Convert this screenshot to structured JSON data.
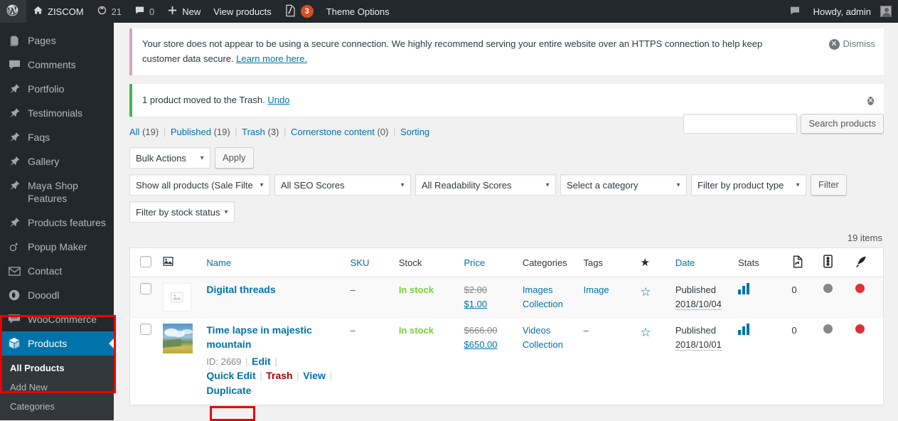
{
  "adminbar": {
    "logo_icon": "wordpress-logo-icon",
    "site_name": "ZISCOM",
    "site_icon": "home-icon",
    "updates_icon": "updates-icon",
    "updates_count": "21",
    "comments_icon": "comment-bubble-icon",
    "comments_count": "0",
    "new_icon": "plus-icon",
    "new_label": "New",
    "view_products_label": "View products",
    "yoast_icon": "yoast-seo-icon",
    "yoast_badge": "3",
    "theme_options_label": "Theme Options",
    "notifications_icon": "notification-bubble-icon",
    "howdy_label": "Howdy, admin",
    "avatar_icon": "user-avatar-icon"
  },
  "sidebar": {
    "items": [
      {
        "label": "Pages",
        "icon": "pages-icon"
      },
      {
        "label": "Comments",
        "icon": "comments-icon"
      },
      {
        "label": "Portfolio",
        "icon": "pin-icon"
      },
      {
        "label": "Testimonials",
        "icon": "pin-icon"
      },
      {
        "label": "Faqs",
        "icon": "pin-icon"
      },
      {
        "label": "Gallery",
        "icon": "pin-icon"
      },
      {
        "label": "Maya Shop Features",
        "icon": "pin-icon"
      },
      {
        "label": "Products features",
        "icon": "pin-icon"
      },
      {
        "label": "Popup Maker",
        "icon": "popup-maker-icon"
      },
      {
        "label": "Contact",
        "icon": "envelope-icon"
      },
      {
        "label": "Dooodl",
        "icon": "dooodl-icon"
      },
      {
        "label": "WooCommerce",
        "icon": "woocommerce-icon"
      }
    ],
    "active_item": {
      "label": "Products",
      "icon": "products-box-icon"
    },
    "submenu": [
      {
        "label": "All Products",
        "current": true
      },
      {
        "label": "Add New",
        "current": false
      },
      {
        "label": "Categories",
        "current": false
      }
    ]
  },
  "notices": {
    "https": {
      "text": "Your store does not appear to be using a secure connection. We highly recommend serving your entire website over an HTTPS connection to help keep customer data secure.",
      "link_text": "Learn more here.",
      "dismiss_label": "Dismiss",
      "dismiss_icon": "dismiss-circle-icon",
      "accent_color": "#d8a2c4"
    },
    "trash": {
      "text": "1 product moved to the Trash.",
      "link_text": "Undo",
      "dismiss_icon": "dismiss-circle-icon",
      "accent_color": "#46b450"
    }
  },
  "views": [
    {
      "label": "All",
      "count": "(19)"
    },
    {
      "label": "Published",
      "count": "(19)"
    },
    {
      "label": "Trash",
      "count": "(3)"
    },
    {
      "label": "Cornerstone content",
      "count": "(0)"
    },
    {
      "label": "Sorting",
      "count": ""
    }
  ],
  "search": {
    "value": "",
    "placeholder": "",
    "button_label": "Search products"
  },
  "toolbar": {
    "bulk_actions_label": "Bulk Actions",
    "apply_label": "Apply",
    "filters": [
      "Show all products (Sale Filte",
      "All SEO Scores",
      "All Readability Scores",
      "Select a category",
      "Filter by product type"
    ],
    "filter_button_label": "Filter",
    "stock_filter_label": "Filter by stock status"
  },
  "count": {
    "items_label": "19 items"
  },
  "table": {
    "headers": [
      {
        "label": "",
        "name": "select-all-checkbox",
        "kind": "checkbox"
      },
      {
        "label": "",
        "name": "thumbnail-icon",
        "kind": "icon-image"
      },
      {
        "label": "Name",
        "name": "col-name",
        "kind": "sortable"
      },
      {
        "label": "SKU",
        "name": "col-sku",
        "kind": "sortable"
      },
      {
        "label": "Stock",
        "name": "col-stock",
        "kind": "plain"
      },
      {
        "label": "Price",
        "name": "col-price",
        "kind": "sortable"
      },
      {
        "label": "Categories",
        "name": "col-categories",
        "kind": "plain"
      },
      {
        "label": "Tags",
        "name": "col-tags",
        "kind": "plain"
      },
      {
        "label": "",
        "name": "col-featured-star",
        "kind": "icon-star"
      },
      {
        "label": "Date",
        "name": "col-date",
        "kind": "sortable"
      },
      {
        "label": "Stats",
        "name": "col-stats",
        "kind": "plain"
      },
      {
        "label": "",
        "name": "col-duplicate-icon",
        "kind": "icon-duplicate"
      },
      {
        "label": "",
        "name": "col-linkcount-icon",
        "kind": "icon-links"
      },
      {
        "label": "",
        "name": "col-readability-icon",
        "kind": "icon-feather"
      }
    ],
    "rows": [
      {
        "name": "Digital threads",
        "thumb": "placeholder",
        "sku": "–",
        "stock": "In stock",
        "price_regular": "$2.00",
        "price_sale": "$1.00",
        "categories": "Images Collection",
        "tags": "Image",
        "featured": "star-empty-icon",
        "date_status": "Published",
        "date_value": "2018/10/04",
        "stats": "stats-bar-icon",
        "links": "0",
        "seo_dot": "#888888",
        "readability_dot": "#dc3232",
        "actions": []
      },
      {
        "name": "Time lapse in majestic mountain",
        "thumb": "mountain-photo",
        "sku": "–",
        "stock": "In stock",
        "price_regular": "$666.00",
        "price_sale": "$650.00",
        "categories": "Videos Collection",
        "tags": "–",
        "featured": "star-empty-icon",
        "date_status": "Published",
        "date_value": "2018/10/01",
        "stats": "stats-bar-icon",
        "links": "0",
        "seo_dot": "#888888",
        "readability_dot": "#dc3232",
        "actions": [
          {
            "label": "ID: 2669",
            "kind": "text"
          },
          {
            "label": "Edit",
            "kind": "link"
          },
          {
            "label": "Quick Edit",
            "kind": "link"
          },
          {
            "label": "Trash",
            "kind": "trash"
          },
          {
            "label": "View",
            "kind": "link"
          },
          {
            "label": "Duplicate",
            "kind": "link"
          }
        ]
      }
    ]
  },
  "highlights": {
    "menu_box_color": "#ef0000",
    "duplicate_box_color": "#ef0000"
  }
}
